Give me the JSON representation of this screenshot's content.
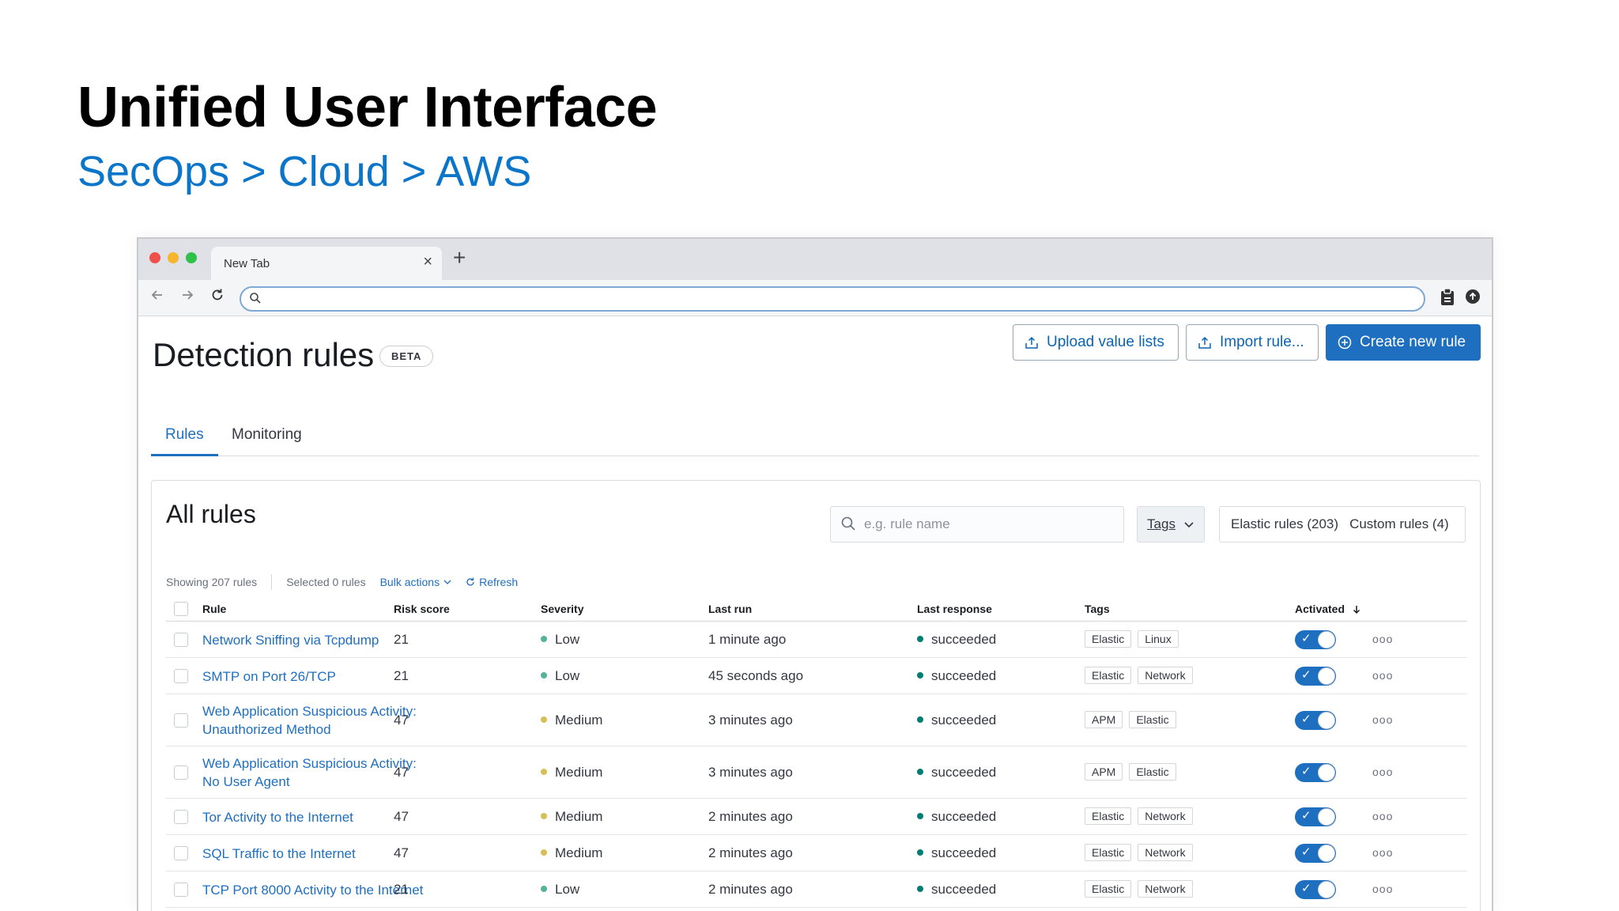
{
  "slide": {
    "title": "Unified User Interface",
    "breadcrumb": "SecOps > Cloud > AWS"
  },
  "browser": {
    "tab_label": "New Tab",
    "tab_close": "×",
    "tab_new": "+",
    "url_value": ""
  },
  "page": {
    "title": "Detection rules",
    "badge": "BETA",
    "buttons": {
      "upload": "Upload value lists",
      "import": "Import rule...",
      "create": "Create new rule"
    },
    "tabs": [
      {
        "label": "Rules",
        "active": true
      },
      {
        "label": "Monitoring",
        "active": false
      }
    ]
  },
  "panel": {
    "title": "All rules",
    "search_placeholder": "e.g. rule name",
    "tags_label": "Tags",
    "filters": [
      "Elastic rules (203)",
      "Custom rules (4)"
    ],
    "meta": {
      "showing": "Showing 207 rules",
      "selected": "Selected 0 rules",
      "bulk": "Bulk actions",
      "refresh": "Refresh"
    },
    "columns": {
      "rule": "Rule",
      "risk": "Risk score",
      "severity": "Severity",
      "last_run": "Last run",
      "last_response": "Last response",
      "tags": "Tags",
      "activated": "Activated"
    },
    "rows": [
      {
        "rule": "Network Sniffing via Tcpdump",
        "rule2": "",
        "risk": "21",
        "severity": "Low",
        "last_run": "1 minute ago",
        "response": "succeeded",
        "tags": [
          "Elastic",
          "Linux"
        ],
        "activated": true
      },
      {
        "rule": "SMTP on Port 26/TCP",
        "rule2": "",
        "risk": "21",
        "severity": "Low",
        "last_run": "45 seconds ago",
        "response": "succeeded",
        "tags": [
          "Elastic",
          "Network"
        ],
        "activated": true
      },
      {
        "rule": "Web Application Suspicious Activity:",
        "rule2": "Unauthorized Method",
        "risk": "47",
        "severity": "Medium",
        "last_run": "3 minutes ago",
        "response": "succeeded",
        "tags": [
          "APM",
          "Elastic"
        ],
        "activated": true
      },
      {
        "rule": "Web Application Suspicious Activity:",
        "rule2": "No User Agent",
        "risk": "47",
        "severity": "Medium",
        "last_run": "3 minutes ago",
        "response": "succeeded",
        "tags": [
          "APM",
          "Elastic"
        ],
        "activated": true
      },
      {
        "rule": "Tor Activity to the Internet",
        "rule2": "",
        "risk": "47",
        "severity": "Medium",
        "last_run": "2 minutes ago",
        "response": "succeeded",
        "tags": [
          "Elastic",
          "Network"
        ],
        "activated": true
      },
      {
        "rule": "SQL Traffic to the Internet",
        "rule2": "",
        "risk": "47",
        "severity": "Medium",
        "last_run": "2 minutes ago",
        "response": "succeeded",
        "tags": [
          "Elastic",
          "Network"
        ],
        "activated": true
      },
      {
        "rule": "TCP Port 8000 Activity to the Internet",
        "rule2": "",
        "risk": "21",
        "severity": "Low",
        "last_run": "2 minutes ago",
        "response": "succeeded",
        "tags": [
          "Elastic",
          "Network"
        ],
        "activated": true
      }
    ],
    "more_glyph": "ooo",
    "colors": {
      "Low": "#54b399",
      "Medium": "#d6bf57",
      "succeeded": "#017d73"
    }
  }
}
